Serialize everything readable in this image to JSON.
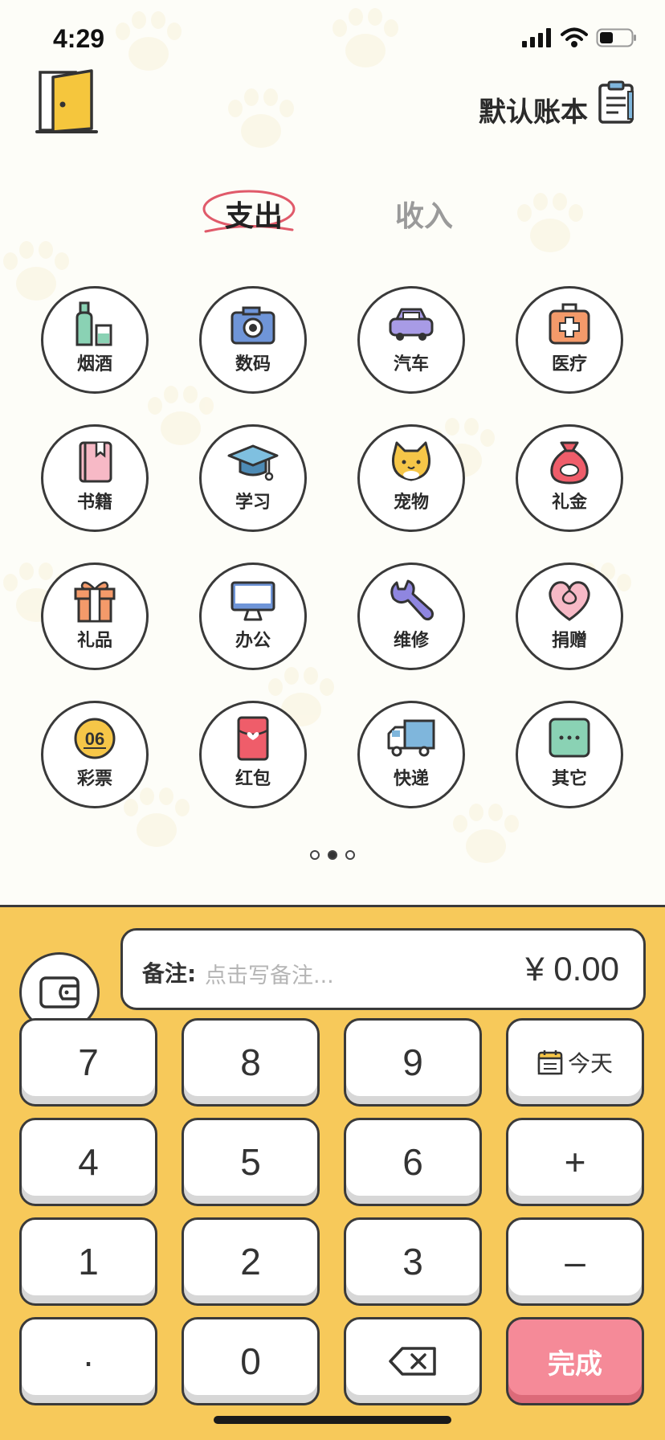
{
  "status_bar": {
    "time": "4:29"
  },
  "header": {
    "book_name": "默认账本"
  },
  "tabs": [
    {
      "label": "支出",
      "active": true
    },
    {
      "label": "收入",
      "active": false
    }
  ],
  "categories": [
    {
      "label": "烟酒",
      "icon": "bottle-icon"
    },
    {
      "label": "数码",
      "icon": "camera-icon"
    },
    {
      "label": "汽车",
      "icon": "car-icon"
    },
    {
      "label": "医疗",
      "icon": "medkit-icon"
    },
    {
      "label": "书籍",
      "icon": "book-icon"
    },
    {
      "label": "学习",
      "icon": "graduation-cap-icon"
    },
    {
      "label": "宠物",
      "icon": "cat-icon"
    },
    {
      "label": "礼金",
      "icon": "money-bag-icon"
    },
    {
      "label": "礼品",
      "icon": "gift-icon"
    },
    {
      "label": "办公",
      "icon": "computer-icon"
    },
    {
      "label": "维修",
      "icon": "wrench-icon"
    },
    {
      "label": "捐赠",
      "icon": "heart-icon"
    },
    {
      "label": "彩票",
      "icon": "lottery-ball-icon",
      "badge": "06"
    },
    {
      "label": "红包",
      "icon": "red-envelope-icon"
    },
    {
      "label": "快递",
      "icon": "truck-icon"
    },
    {
      "label": "其它",
      "icon": "more-icon"
    }
  ],
  "pager": {
    "pages": 3,
    "current": 2
  },
  "note": {
    "label": "备注:",
    "placeholder": "点击写备注...",
    "amount": "¥ 0.00"
  },
  "keys": {
    "k7": "7",
    "k8": "8",
    "k9": "9",
    "date": "今天",
    "k4": "4",
    "k5": "5",
    "k6": "6",
    "plus": "+",
    "k1": "1",
    "k2": "2",
    "k3": "3",
    "minus": "–",
    "dot": "·",
    "k0": "0",
    "done": "完成"
  },
  "colors": {
    "keypad_bg": "#f7c95a",
    "done": "#f58a98",
    "outline": "#3a3a3a",
    "tab_underline": "#e05a6a"
  }
}
